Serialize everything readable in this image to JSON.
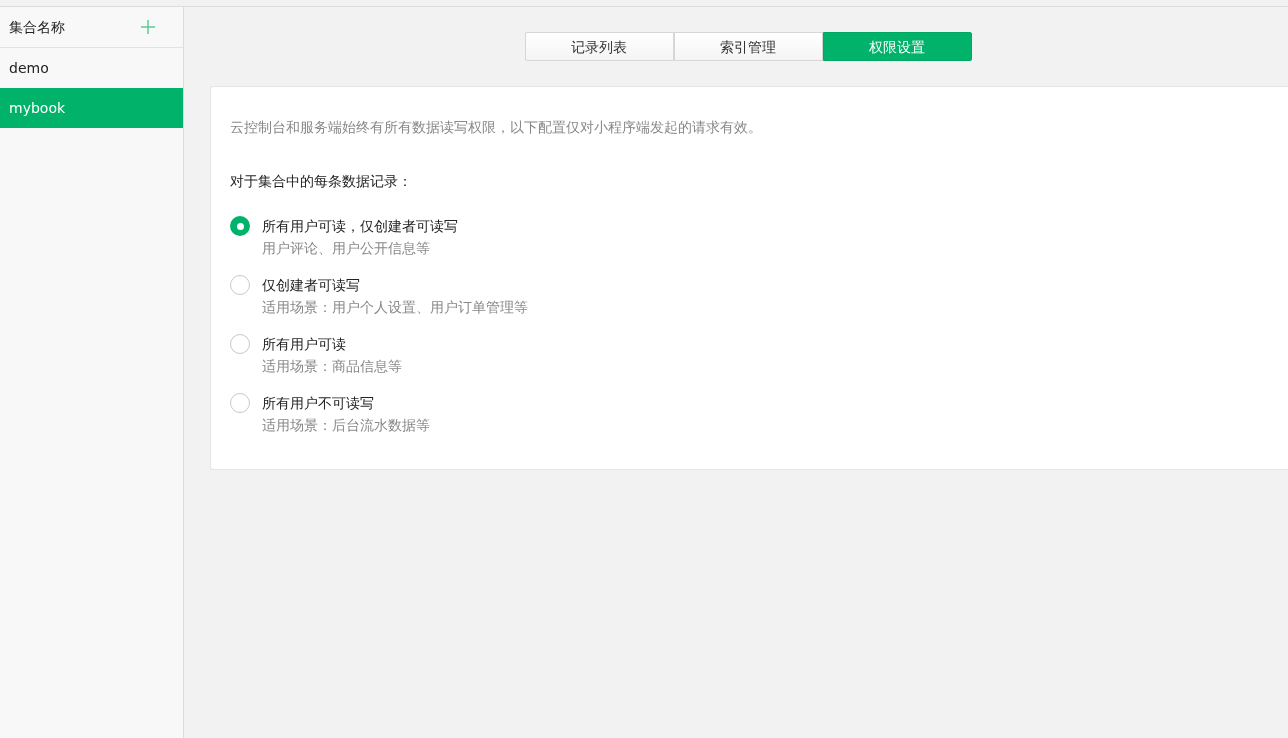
{
  "sidebar": {
    "title": "集合名称",
    "items": [
      {
        "label": "demo",
        "selected": false
      },
      {
        "label": "mybook",
        "selected": true
      }
    ]
  },
  "tabs": [
    {
      "label": "记录列表",
      "selected": false
    },
    {
      "label": "索引管理",
      "selected": false
    },
    {
      "label": "权限设置",
      "selected": true
    }
  ],
  "permissions": {
    "note": "云控制台和服务端始终有所有数据读写权限，以下配置仅对小程序端发起的请求有效。",
    "heading": "对于集合中的每条数据记录：",
    "options": [
      {
        "label": "所有用户可读，仅创建者可读写",
        "description": "用户评论、用户公开信息等",
        "selected": true
      },
      {
        "label": "仅创建者可读写",
        "description": "适用场景：用户个人设置、用户订单管理等",
        "selected": false
      },
      {
        "label": "所有用户可读",
        "description": "适用场景：商品信息等",
        "selected": false
      },
      {
        "label": "所有用户不可读写",
        "description": "适用场景：后台流水数据等",
        "selected": false
      }
    ]
  }
}
